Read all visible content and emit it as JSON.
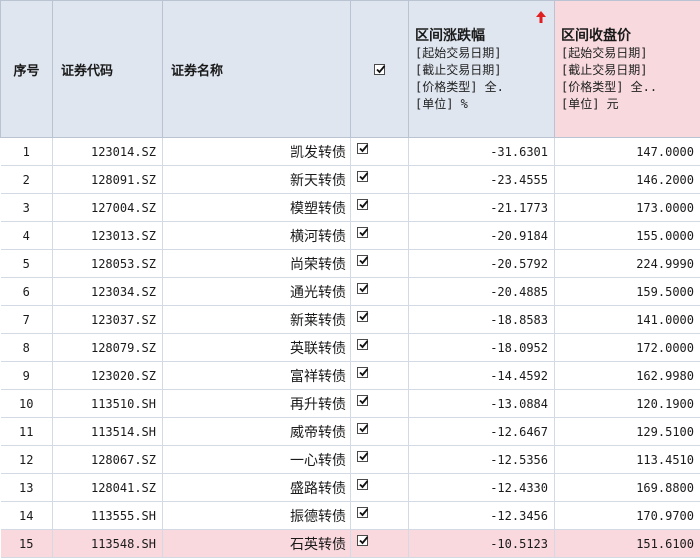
{
  "header": {
    "index": "序号",
    "code": "证券代码",
    "name": "证券名称",
    "range_change": {
      "title": "区间涨跌幅",
      "lines": [
        "[起始交易日期]",
        "[截止交易日期]",
        "[价格类型]  全.",
        "[单位]  %"
      ]
    },
    "range_close": {
      "title": "区间收盘价",
      "lines": [
        "[起始交易日期]",
        "[截止交易日期]",
        "[价格类型]  全..",
        "[单位]  元"
      ]
    }
  },
  "colors": {
    "header_bg": "#dfe6f0",
    "close_header_bg": "#f7d9de",
    "selected_row_bg": "#f9d8de",
    "sort_arrow": "#e02020"
  },
  "rows": [
    {
      "index": "1",
      "code": "123014.SZ",
      "name": "凯发转债",
      "change": "-31.6301",
      "close": "147.0000"
    },
    {
      "index": "2",
      "code": "128091.SZ",
      "name": "新天转债",
      "change": "-23.4555",
      "close": "146.2000"
    },
    {
      "index": "3",
      "code": "127004.SZ",
      "name": "模塑转债",
      "change": "-21.1773",
      "close": "173.0000"
    },
    {
      "index": "4",
      "code": "123013.SZ",
      "name": "横河转债",
      "change": "-20.9184",
      "close": "155.0000"
    },
    {
      "index": "5",
      "code": "128053.SZ",
      "name": "尚荣转债",
      "change": "-20.5792",
      "close": "224.9990"
    },
    {
      "index": "6",
      "code": "123034.SZ",
      "name": "通光转债",
      "change": "-20.4885",
      "close": "159.5000"
    },
    {
      "index": "7",
      "code": "123037.SZ",
      "name": "新莱转债",
      "change": "-18.8583",
      "close": "141.0000"
    },
    {
      "index": "8",
      "code": "128079.SZ",
      "name": "英联转债",
      "change": "-18.0952",
      "close": "172.0000"
    },
    {
      "index": "9",
      "code": "123020.SZ",
      "name": "富祥转债",
      "change": "-14.4592",
      "close": "162.9980"
    },
    {
      "index": "10",
      "code": "113510.SH",
      "name": "再升转债",
      "change": "-13.0884",
      "close": "120.1900"
    },
    {
      "index": "11",
      "code": "113514.SH",
      "name": "威帝转债",
      "change": "-12.6467",
      "close": "129.5100"
    },
    {
      "index": "12",
      "code": "128067.SZ",
      "name": "一心转债",
      "change": "-12.5356",
      "close": "113.4510"
    },
    {
      "index": "13",
      "code": "128041.SZ",
      "name": "盛路转债",
      "change": "-12.4330",
      "close": "169.8800"
    },
    {
      "index": "14",
      "code": "113555.SH",
      "name": "振德转债",
      "change": "-12.3456",
      "close": "170.9700"
    },
    {
      "index": "15",
      "code": "113548.SH",
      "name": "石英转债",
      "change": "-10.5123",
      "close": "151.6100"
    }
  ],
  "selected_row": 14
}
